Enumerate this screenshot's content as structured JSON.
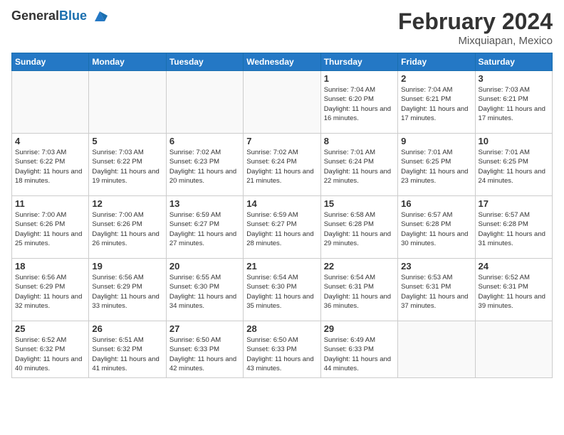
{
  "logo": {
    "general": "General",
    "blue": "Blue"
  },
  "title": {
    "month_year": "February 2024",
    "location": "Mixquiapan, Mexico"
  },
  "days_of_week": [
    "Sunday",
    "Monday",
    "Tuesday",
    "Wednesday",
    "Thursday",
    "Friday",
    "Saturday"
  ],
  "weeks": [
    [
      {
        "day": "",
        "info": ""
      },
      {
        "day": "",
        "info": ""
      },
      {
        "day": "",
        "info": ""
      },
      {
        "day": "",
        "info": ""
      },
      {
        "day": "1",
        "info": "Sunrise: 7:04 AM\nSunset: 6:20 PM\nDaylight: 11 hours\nand 16 minutes."
      },
      {
        "day": "2",
        "info": "Sunrise: 7:04 AM\nSunset: 6:21 PM\nDaylight: 11 hours\nand 17 minutes."
      },
      {
        "day": "3",
        "info": "Sunrise: 7:03 AM\nSunset: 6:21 PM\nDaylight: 11 hours\nand 17 minutes."
      }
    ],
    [
      {
        "day": "4",
        "info": "Sunrise: 7:03 AM\nSunset: 6:22 PM\nDaylight: 11 hours\nand 18 minutes."
      },
      {
        "day": "5",
        "info": "Sunrise: 7:03 AM\nSunset: 6:22 PM\nDaylight: 11 hours\nand 19 minutes."
      },
      {
        "day": "6",
        "info": "Sunrise: 7:02 AM\nSunset: 6:23 PM\nDaylight: 11 hours\nand 20 minutes."
      },
      {
        "day": "7",
        "info": "Sunrise: 7:02 AM\nSunset: 6:24 PM\nDaylight: 11 hours\nand 21 minutes."
      },
      {
        "day": "8",
        "info": "Sunrise: 7:01 AM\nSunset: 6:24 PM\nDaylight: 11 hours\nand 22 minutes."
      },
      {
        "day": "9",
        "info": "Sunrise: 7:01 AM\nSunset: 6:25 PM\nDaylight: 11 hours\nand 23 minutes."
      },
      {
        "day": "10",
        "info": "Sunrise: 7:01 AM\nSunset: 6:25 PM\nDaylight: 11 hours\nand 24 minutes."
      }
    ],
    [
      {
        "day": "11",
        "info": "Sunrise: 7:00 AM\nSunset: 6:26 PM\nDaylight: 11 hours\nand 25 minutes."
      },
      {
        "day": "12",
        "info": "Sunrise: 7:00 AM\nSunset: 6:26 PM\nDaylight: 11 hours\nand 26 minutes."
      },
      {
        "day": "13",
        "info": "Sunrise: 6:59 AM\nSunset: 6:27 PM\nDaylight: 11 hours\nand 27 minutes."
      },
      {
        "day": "14",
        "info": "Sunrise: 6:59 AM\nSunset: 6:27 PM\nDaylight: 11 hours\nand 28 minutes."
      },
      {
        "day": "15",
        "info": "Sunrise: 6:58 AM\nSunset: 6:28 PM\nDaylight: 11 hours\nand 29 minutes."
      },
      {
        "day": "16",
        "info": "Sunrise: 6:57 AM\nSunset: 6:28 PM\nDaylight: 11 hours\nand 30 minutes."
      },
      {
        "day": "17",
        "info": "Sunrise: 6:57 AM\nSunset: 6:28 PM\nDaylight: 11 hours\nand 31 minutes."
      }
    ],
    [
      {
        "day": "18",
        "info": "Sunrise: 6:56 AM\nSunset: 6:29 PM\nDaylight: 11 hours\nand 32 minutes."
      },
      {
        "day": "19",
        "info": "Sunrise: 6:56 AM\nSunset: 6:29 PM\nDaylight: 11 hours\nand 33 minutes."
      },
      {
        "day": "20",
        "info": "Sunrise: 6:55 AM\nSunset: 6:30 PM\nDaylight: 11 hours\nand 34 minutes."
      },
      {
        "day": "21",
        "info": "Sunrise: 6:54 AM\nSunset: 6:30 PM\nDaylight: 11 hours\nand 35 minutes."
      },
      {
        "day": "22",
        "info": "Sunrise: 6:54 AM\nSunset: 6:31 PM\nDaylight: 11 hours\nand 36 minutes."
      },
      {
        "day": "23",
        "info": "Sunrise: 6:53 AM\nSunset: 6:31 PM\nDaylight: 11 hours\nand 37 minutes."
      },
      {
        "day": "24",
        "info": "Sunrise: 6:52 AM\nSunset: 6:31 PM\nDaylight: 11 hours\nand 39 minutes."
      }
    ],
    [
      {
        "day": "25",
        "info": "Sunrise: 6:52 AM\nSunset: 6:32 PM\nDaylight: 11 hours\nand 40 minutes."
      },
      {
        "day": "26",
        "info": "Sunrise: 6:51 AM\nSunset: 6:32 PM\nDaylight: 11 hours\nand 41 minutes."
      },
      {
        "day": "27",
        "info": "Sunrise: 6:50 AM\nSunset: 6:33 PM\nDaylight: 11 hours\nand 42 minutes."
      },
      {
        "day": "28",
        "info": "Sunrise: 6:50 AM\nSunset: 6:33 PM\nDaylight: 11 hours\nand 43 minutes."
      },
      {
        "day": "29",
        "info": "Sunrise: 6:49 AM\nSunset: 6:33 PM\nDaylight: 11 hours\nand 44 minutes."
      },
      {
        "day": "",
        "info": ""
      },
      {
        "day": "",
        "info": ""
      }
    ]
  ]
}
